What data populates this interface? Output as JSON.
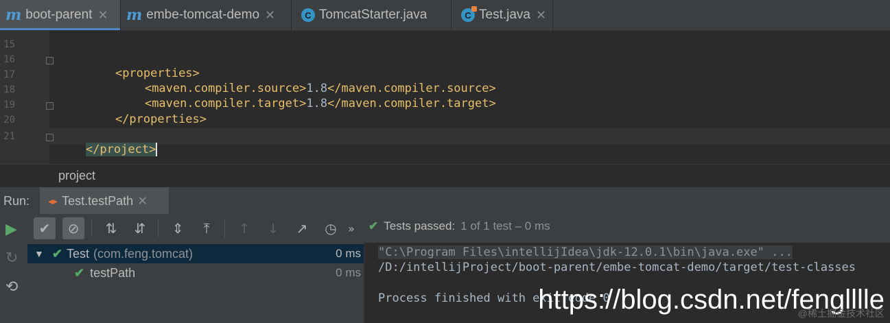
{
  "tabs": [
    {
      "label": "boot-parent",
      "icon": "maven-icon",
      "active": true
    },
    {
      "label": "embe-tomcat-demo",
      "icon": "maven-icon",
      "active": false
    },
    {
      "label": "TomcatStarter.java",
      "icon": "class-icon",
      "active": false
    },
    {
      "label": "Test.java",
      "icon": "test-class-icon",
      "active": false
    }
  ],
  "editor": {
    "lines": [
      {
        "n": "15",
        "text": ""
      },
      {
        "n": "16",
        "open": "<properties>"
      },
      {
        "n": "17",
        "open": "<maven.compiler.source>",
        "value": "1.8",
        "close": "</maven.compiler.source>"
      },
      {
        "n": "18",
        "open": "<maven.compiler.target>",
        "value": "1.8",
        "close": "</maven.compiler.target>"
      },
      {
        "n": "19",
        "close": "</properties>"
      },
      {
        "n": "20",
        "text": ""
      },
      {
        "n": "21",
        "close": "</project>"
      }
    ]
  },
  "breadcrumb": "project",
  "run": {
    "label": "Run:",
    "tab_label": "Test.testPath",
    "status": {
      "title": "Tests passed:",
      "count": "1 of 1 test – 0 ms"
    },
    "more": "»"
  },
  "tree": [
    {
      "name": "Test",
      "package": "(com.feng.tomcat)",
      "duration": "0 ms"
    },
    {
      "name": "testPath",
      "duration": "0 ms"
    }
  ],
  "console": {
    "line1": "\"C:\\Program Files\\intellijIdea\\jdk-12.0.1\\bin\\java.exe\" ...",
    "line2": "/D:/intellijProject/boot-parent/embe-tomcat-demo/target/test-classes",
    "line3": "Process finished with exit code 0"
  },
  "watermark": "https://blog.csdn.net/fenglllle",
  "watermark_sub": "@稀土掘金技术社区",
  "colors": {
    "accent": "#4a88c7",
    "pass": "#59a869",
    "tag": "#e8bf6a"
  }
}
